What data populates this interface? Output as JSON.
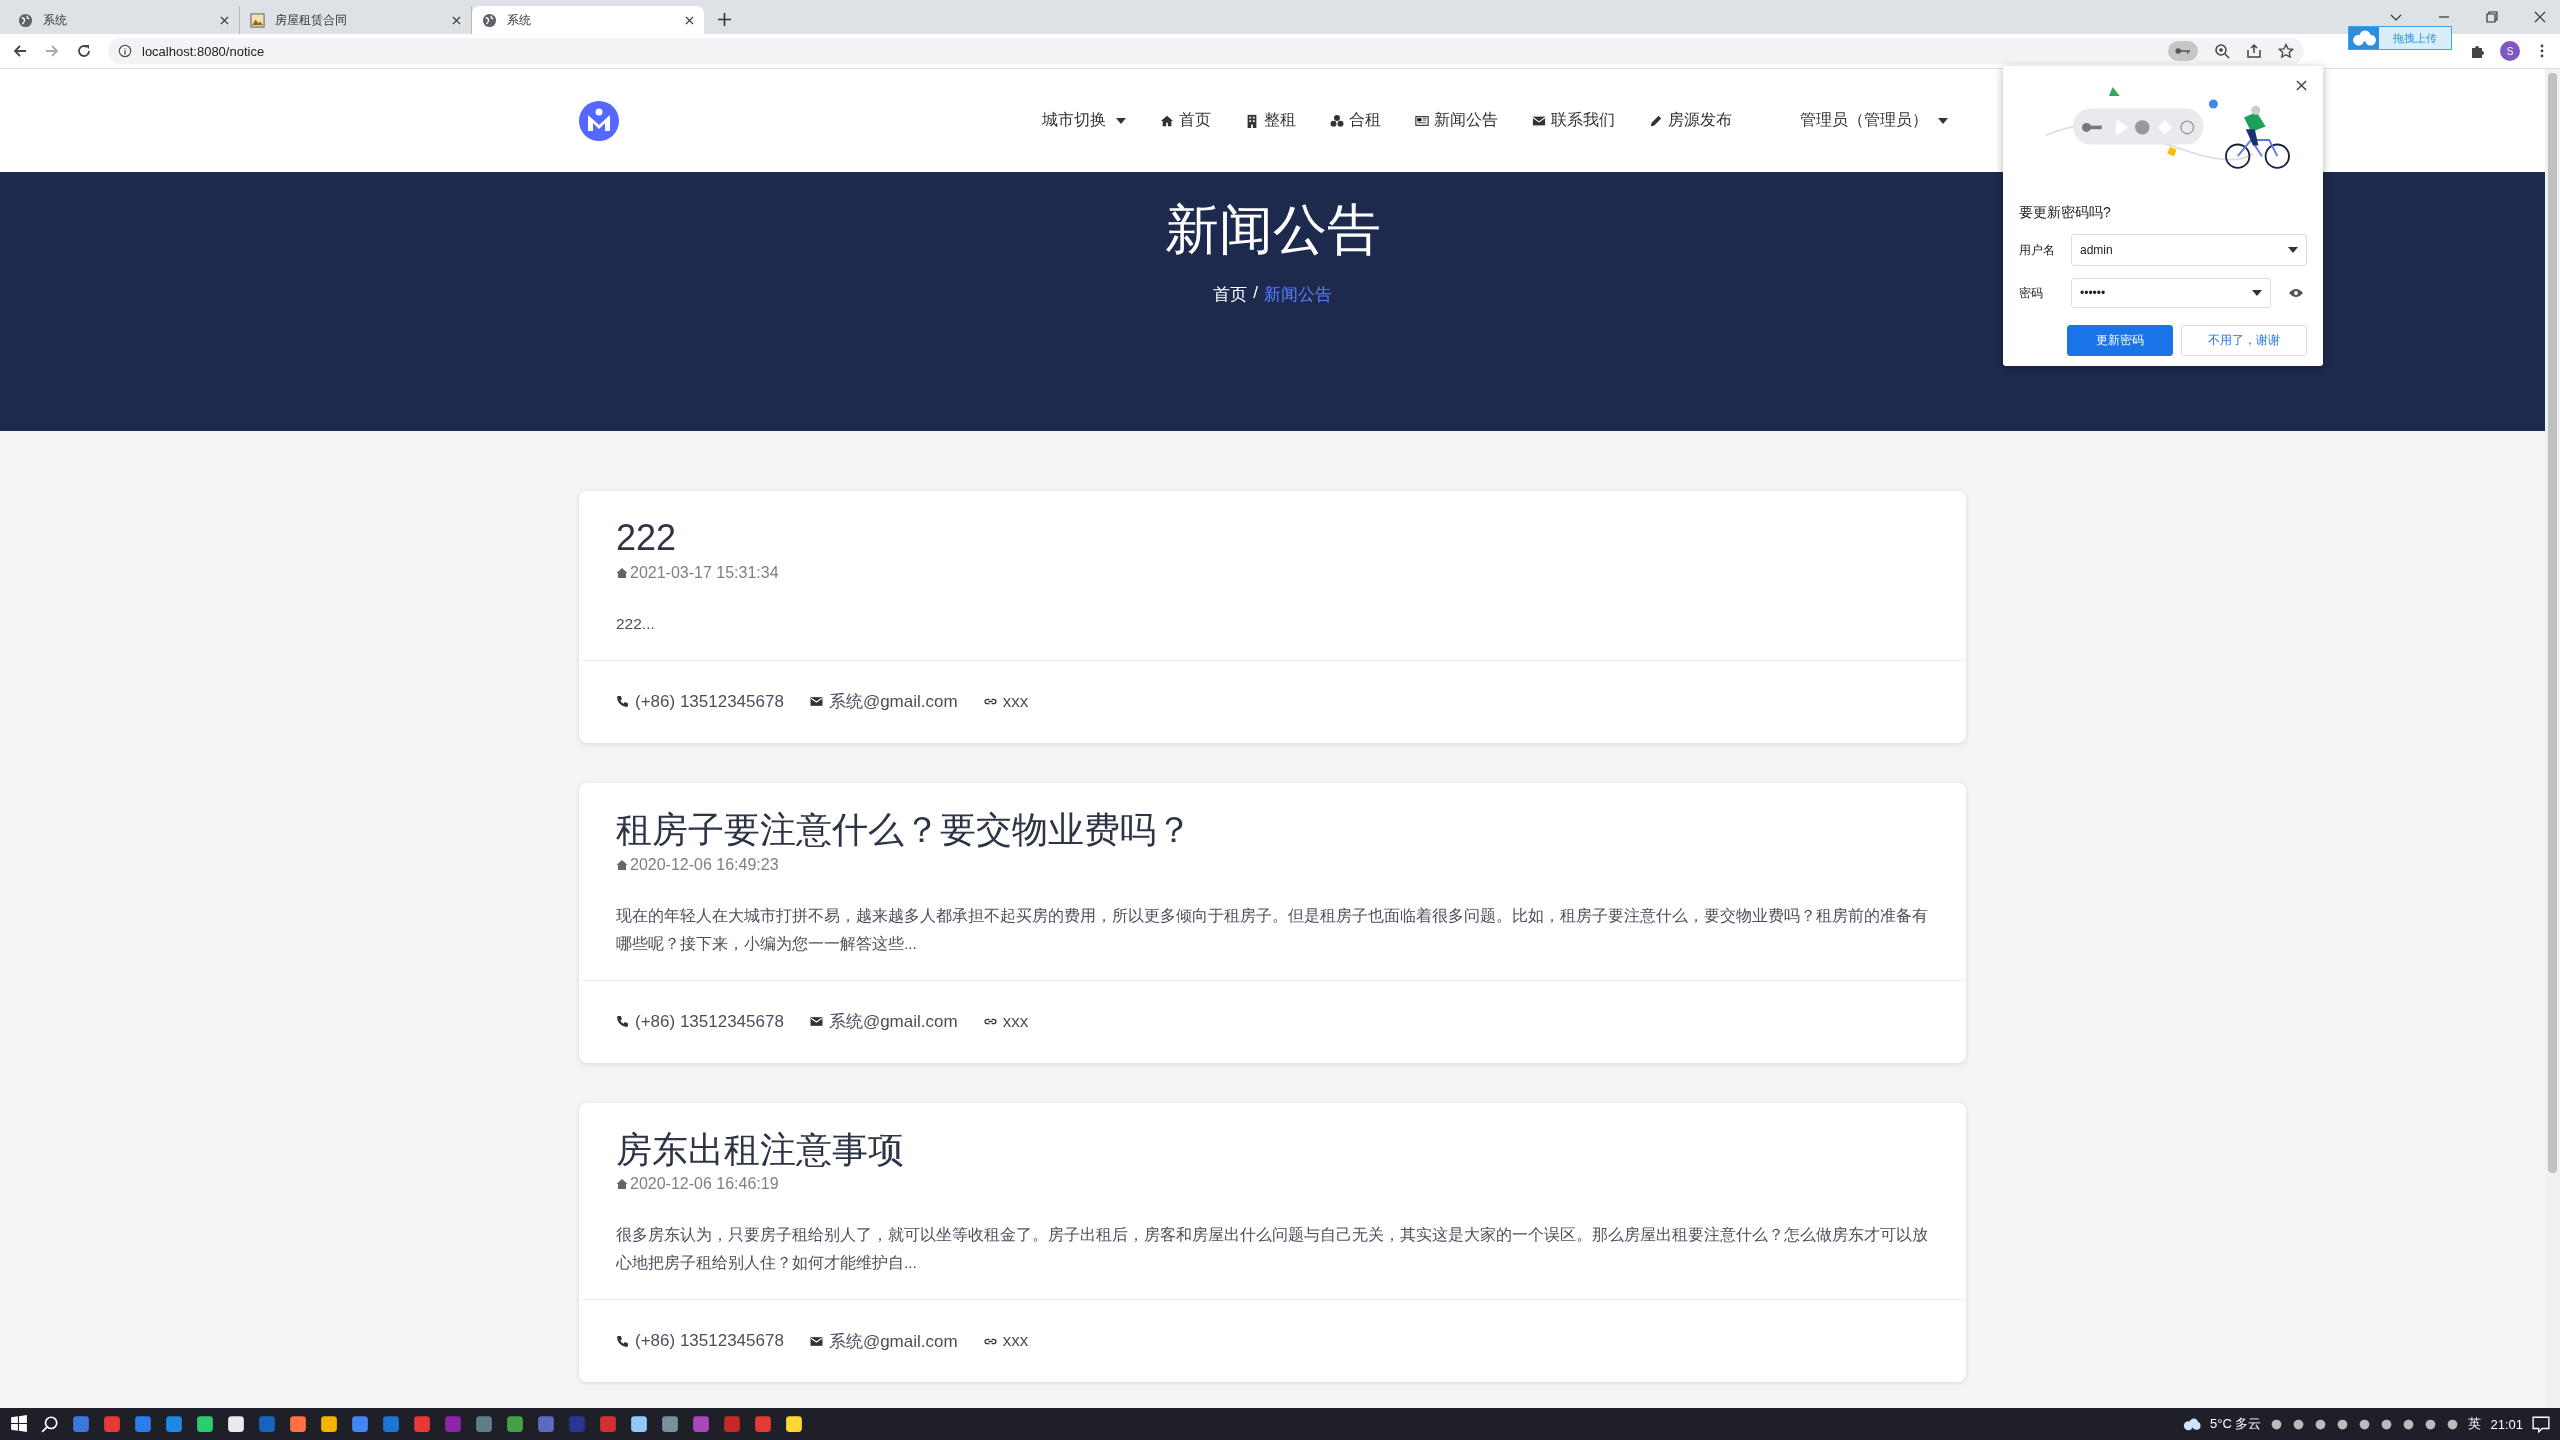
{
  "browser": {
    "tabs": [
      {
        "title": "系统",
        "kind": "globe",
        "selected": false
      },
      {
        "title": "房屋租赁合同",
        "kind": "image",
        "selected": false
      },
      {
        "title": "系统",
        "kind": "globe",
        "selected": true
      }
    ],
    "url": "localhost:8080/notice",
    "upload_badge": "拖拽上传",
    "profile_initial": "S"
  },
  "nav": {
    "items": [
      {
        "label": "城市切换",
        "dropdown": true
      },
      {
        "label": "首页",
        "dropdown": false
      },
      {
        "label": "整租",
        "dropdown": false
      },
      {
        "label": "合租",
        "dropdown": false
      },
      {
        "label": "新闻公告",
        "dropdown": false
      },
      {
        "label": "联系我们",
        "dropdown": false
      },
      {
        "label": "房源发布",
        "dropdown": false
      }
    ],
    "user": {
      "label": "管理员（管理员）",
      "dropdown": true
    }
  },
  "hero": {
    "title": "新闻公告",
    "breadcrumb": {
      "home": "首页",
      "separator": "/",
      "current": "新闻公告"
    }
  },
  "notices": [
    {
      "title": "222",
      "date": "2021-03-17 15:31:34",
      "summary": "222...",
      "phone": "(+86) 13512345678",
      "email": "系统@gmail.com",
      "link": "xxx"
    },
    {
      "title": "租房子要注意什么？要交物业费吗？",
      "date": "2020-12-06 16:49:23",
      "summary": "现在的年轻人在大城市打拼不易，越来越多人都承担不起买房的费用，所以更多倾向于租房子。但是租房子也面临着很多问题。比如，租房子要注意什么，要交物业费吗？租房前的准备有哪些呢？接下来，小编为您一一解答这些...",
      "phone": "(+86) 13512345678",
      "email": "系统@gmail.com",
      "link": "xxx"
    },
    {
      "title": "房东出租注意事项",
      "date": "2020-12-06 16:46:19",
      "summary": "很多房东认为，只要房子租给别人了，就可以坐等收租金了。房子出租后，房客和房屋出什么问题与自己无关，其实这是大家的一个误区。那么房屋出租要注意什么？怎么做房东才可以放心地把房子租给别人住？如何才能维护自...",
      "phone": "(+86) 13512345678",
      "email": "系统@gmail.com",
      "link": "xxx"
    }
  ],
  "password_popup": {
    "question": "要更新密码吗?",
    "username_label": "用户名",
    "username": "admin",
    "password_label": "密码",
    "password": "••••••",
    "primary_button": "更新密码",
    "secondary_button": "不用了，谢谢"
  },
  "taskbar": {
    "weather": "5°C 多云",
    "input_method": "英",
    "time": "21:01"
  }
}
